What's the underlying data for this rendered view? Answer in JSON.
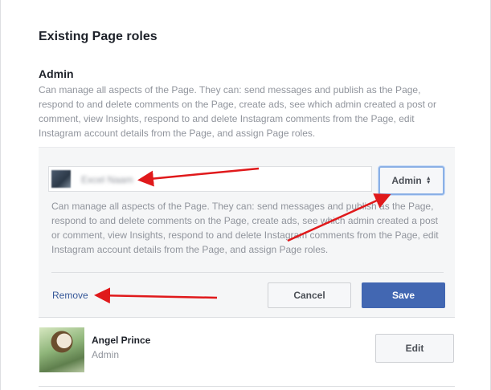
{
  "section": {
    "title": "Existing Page roles"
  },
  "admin_role": {
    "heading": "Admin",
    "description": "Can manage all aspects of the Page. They can: send messages and publish as the Page, respond to and delete comments on the Page, create ads, see which admin created a post or comment, view Insights, respond to and delete Instagram comments from the Page, edit Instagram account details from the Page, and assign Page roles."
  },
  "edit_panel": {
    "person_name": "Excel Naam",
    "role_select": {
      "value": "Admin",
      "icon": "updown-arrows-icon"
    },
    "description": "Can manage all aspects of the Page. They can: send messages and publish as the Page, respond to and delete comments on the Page, create ads, see which admin created a post or comment, view Insights, respond to and delete Instagram comments from the Page, edit Instagram account details from the Page, and assign Page roles.",
    "remove_label": "Remove",
    "cancel_label": "Cancel",
    "save_label": "Save"
  },
  "members": [
    {
      "name": "Angel Prince",
      "role": "Admin",
      "edit_label": "Edit"
    }
  ],
  "colors": {
    "link": "#365899",
    "primary_button": "#4267b2",
    "annotation_arrow": "#e0191b",
    "muted_text": "#90949c"
  }
}
